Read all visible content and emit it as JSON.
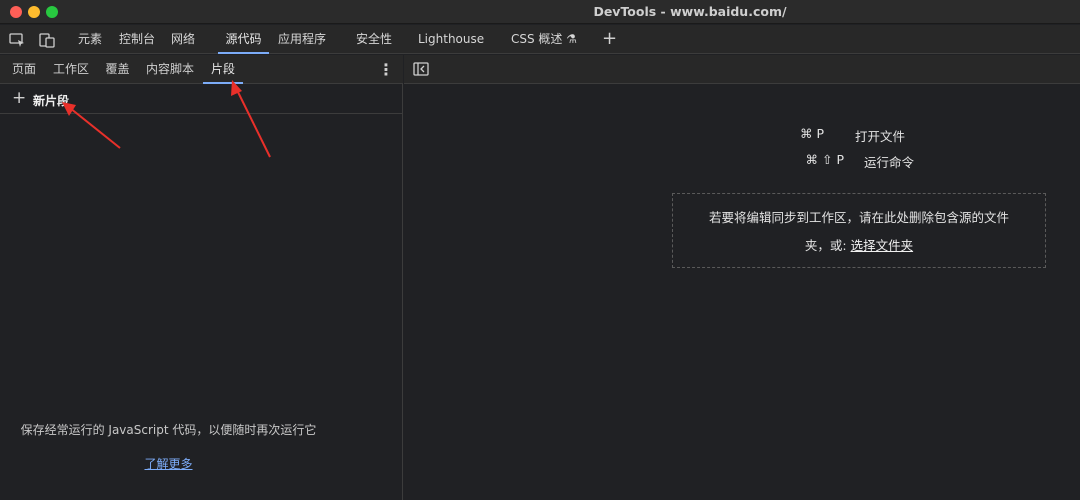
{
  "window": {
    "title": "DevTools - www.baidu.com/"
  },
  "main_tabs": [
    {
      "label": "元素"
    },
    {
      "label": "控制台"
    },
    {
      "label": "网络"
    },
    {
      "label": "源代码"
    },
    {
      "label": "应用程序"
    },
    {
      "label": "安全性"
    },
    {
      "label": "Lighthouse"
    },
    {
      "label": "CSS 概述 ⚗"
    }
  ],
  "sources": {
    "sub_tabs": [
      {
        "label": "页面"
      },
      {
        "label": "工作区"
      },
      {
        "label": "覆盖"
      },
      {
        "label": "内容脚本"
      },
      {
        "label": "片段"
      }
    ],
    "new_snippet_label": "新片段",
    "empty_message": "保存经常运行的 JavaScript 代码，以便随时再次运行它",
    "learn_more": "了解更多"
  },
  "editor": {
    "shortcuts": [
      {
        "key": "⌘ P",
        "label": "打开文件"
      },
      {
        "key": "⌘ ⇧ P",
        "label": "运行命令"
      }
    ],
    "dropzone_line1": "若要将编辑同步到工作区，请在此处删除包含源的文件",
    "dropzone_prefix": "夹，或: ",
    "dropzone_link": "选择文件夹"
  },
  "colors": {
    "accent": "#7cacf8",
    "annotation_arrow": "#e8302a"
  }
}
